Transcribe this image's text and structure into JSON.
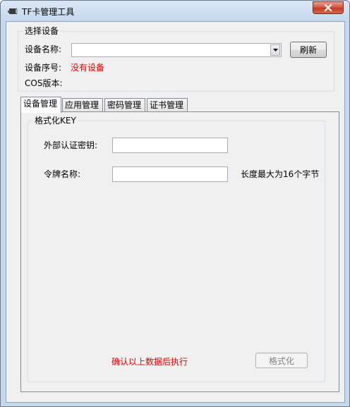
{
  "window": {
    "title": "TF卡管理工具"
  },
  "select_device": {
    "group_title": "选择设备",
    "device_name_label": "设备名称:",
    "device_name_value": "",
    "refresh_button": "刷新",
    "serial_label": "设备序号:",
    "serial_value": "没有设备",
    "cos_label": "COS版本:",
    "cos_value": ""
  },
  "tabs": [
    {
      "label": "设备管理",
      "active": true
    },
    {
      "label": "应用管理",
      "active": false
    },
    {
      "label": "密码管理",
      "active": false
    },
    {
      "label": "证书管理",
      "active": false
    }
  ],
  "format_key": {
    "group_title": "格式化KEY",
    "ext_auth_label": "外部认证密钥:",
    "ext_auth_value": "",
    "token_name_label": "令牌名称:",
    "token_name_value": "",
    "token_hint": "长度最大为16个字节",
    "confirm_text": "确认以上数据后执行",
    "format_button": "格式化",
    "format_button_disabled": true
  },
  "colors": {
    "warning_red": "#e00000",
    "titlebar_blue": "#c5d8ee",
    "close_red": "#c23b22"
  },
  "icons": [
    "app-icon",
    "close-icon",
    "dropdown-arrow-icon"
  ]
}
